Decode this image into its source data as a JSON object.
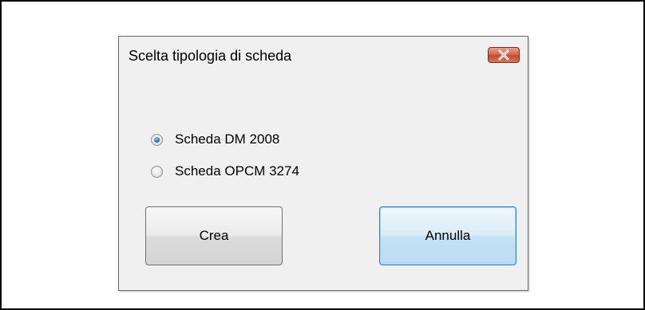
{
  "dialog": {
    "title": "Scelta tipologia di scheda",
    "close_icon": "close-icon"
  },
  "options": [
    {
      "label": "Scheda DM 2008",
      "checked": true
    },
    {
      "label": "Scheda OPCM 3274",
      "checked": false
    }
  ],
  "buttons": {
    "create_label": "Crea",
    "cancel_label": "Annulla"
  },
  "colors": {
    "close_button": "#c75a3f",
    "focus_border": "#3c7fb1",
    "radio_dot": "#2b6fb8"
  }
}
